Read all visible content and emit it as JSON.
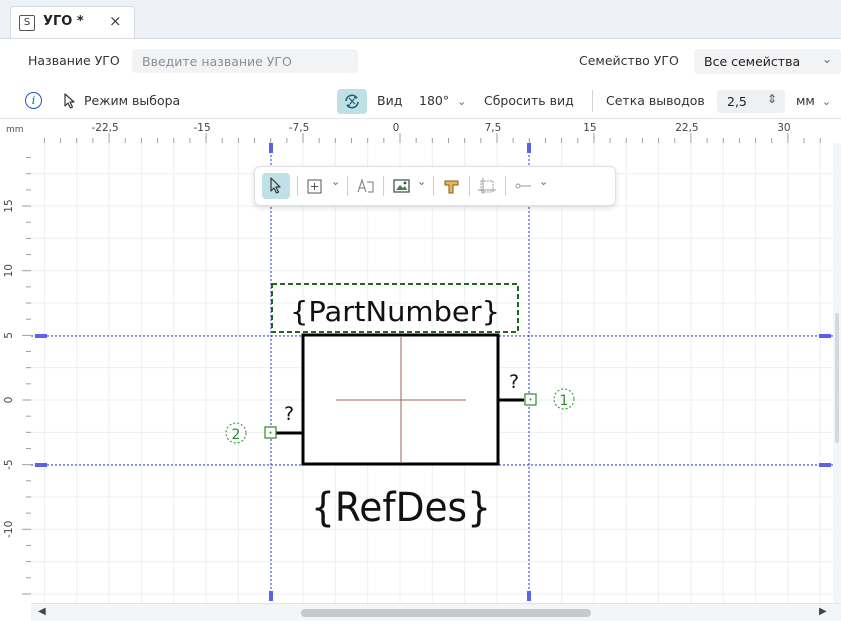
{
  "tab": {
    "icon": "S",
    "title": "УГО *",
    "close": "×"
  },
  "name_bar": {
    "name_label": "Название УГО",
    "name_placeholder": "Введите название УГО",
    "family_label": "Семейство УГО",
    "family_value": "Все семейства"
  },
  "toolbar": {
    "mode_label": "Режим выбора",
    "view_label": "Вид",
    "rotation": "180°",
    "reset_view": "Сбросить вид",
    "grid_label": "Сетка выводов",
    "grid_value": "2,5",
    "unit": "мм"
  },
  "ruler": {
    "unit": "mm",
    "top_labels": [
      "-22,5",
      "-15",
      "-7,5",
      "0",
      "7,5",
      "15",
      "22,5",
      "30"
    ],
    "left_labels": [
      "15",
      "10",
      "5",
      "0",
      "-5",
      "-10"
    ]
  },
  "float_toolbar": {
    "items": [
      "select-icon",
      "grid-add-icon",
      "text-icon",
      "image-icon",
      "pin-icon",
      "resize-icon",
      "line-icon"
    ]
  },
  "symbol": {
    "part_number": "{PartNumber}",
    "ref_des": "{RefDes}",
    "pin1_label": "?",
    "pin2_label": "?",
    "pin1_number": "1",
    "pin2_number": "2"
  },
  "colors": {
    "accent": "#bfe0e6",
    "guide": "#2e39d6",
    "pin": "#2a8a2a",
    "body": "#000000",
    "center": "#a0605a"
  }
}
